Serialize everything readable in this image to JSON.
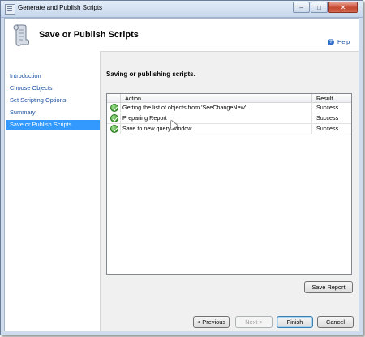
{
  "window": {
    "title": "Generate and Publish Scripts"
  },
  "header": {
    "title": "Save or Publish Scripts"
  },
  "nav": {
    "items": [
      {
        "label": "Introduction",
        "selected": false
      },
      {
        "label": "Choose Objects",
        "selected": false
      },
      {
        "label": "Set Scripting Options",
        "selected": false
      },
      {
        "label": "Summary",
        "selected": false
      },
      {
        "label": "Save or Publish Scripts",
        "selected": true
      }
    ]
  },
  "help": {
    "label": "Help",
    "icon": "help-icon"
  },
  "main": {
    "heading": "Saving or publishing scripts.",
    "table": {
      "columns": [
        "Action",
        "Result"
      ],
      "rows": [
        {
          "action": "Getting the list of objects from 'SeeChangeNew'.",
          "result": "Success",
          "icon": "success-check-icon"
        },
        {
          "action": "Preparing Report",
          "result": "Success",
          "icon": "success-check-icon"
        },
        {
          "action": "Save to new query window",
          "result": "Success",
          "icon": "success-check-icon"
        }
      ]
    },
    "save_report_label": "Save Report"
  },
  "footer": {
    "previous_label": "< Previous",
    "next_label": "Next >",
    "finish_label": "Finish",
    "cancel_label": "Cancel"
  },
  "colors": {
    "selection": "#3399ff",
    "link": "#1a4fa3",
    "success": "#3f9a2e"
  }
}
